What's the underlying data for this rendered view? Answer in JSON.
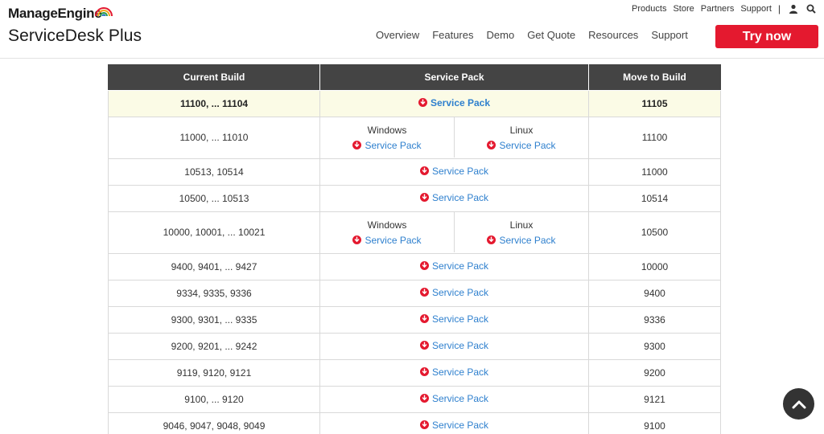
{
  "brand": {
    "company": "ManageEngine",
    "product": "ServiceDesk Plus"
  },
  "toplinks": {
    "items": [
      "Products",
      "Store",
      "Partners",
      "Support"
    ],
    "separator": "|"
  },
  "nav": {
    "items": [
      "Overview",
      "Features",
      "Demo",
      "Get Quote",
      "Resources",
      "Support"
    ]
  },
  "cta": {
    "label": "Try now",
    "color": "#e4192f"
  },
  "table": {
    "headers": [
      "Current Build",
      "Service Pack",
      "Move to Build"
    ],
    "link_label": "Service Pack",
    "windows_label": "Windows",
    "linux_label": "Linux",
    "rows": [
      {
        "current": "11100, ... 11104",
        "move": "11105",
        "split": false
      },
      {
        "current": "11000, ... 11010",
        "move": "11100",
        "split": true
      },
      {
        "current": "10513, 10514",
        "move": "11000",
        "split": false
      },
      {
        "current": "10500, ... 10513",
        "move": "10514",
        "split": false
      },
      {
        "current": "10000, 10001, ... 10021",
        "move": "10500",
        "split": true
      },
      {
        "current": "9400, 9401, ... 9427",
        "move": "10000",
        "split": false
      },
      {
        "current": "9334, 9335, 9336",
        "move": "9400",
        "split": false
      },
      {
        "current": "9300, 9301, ... 9335",
        "move": "9336",
        "split": false
      },
      {
        "current": "9200, 9201, ... 9242",
        "move": "9300",
        "split": false
      },
      {
        "current": "9119, 9120, 9121",
        "move": "9200",
        "split": false
      },
      {
        "current": "9100, ... 9120",
        "move": "9121",
        "split": false
      },
      {
        "current": "9046, 9047, 9048, 9049",
        "move": "9100",
        "split": false
      }
    ]
  },
  "icons": {
    "download": "download-icon",
    "user": "user-icon",
    "search": "search-icon",
    "scroll_top": "chevron-up-icon"
  },
  "colors": {
    "link": "#2f80ce",
    "download_icon": "#e4192f",
    "header_bg": "#444444",
    "highlight_row": "#fbfbe6"
  }
}
